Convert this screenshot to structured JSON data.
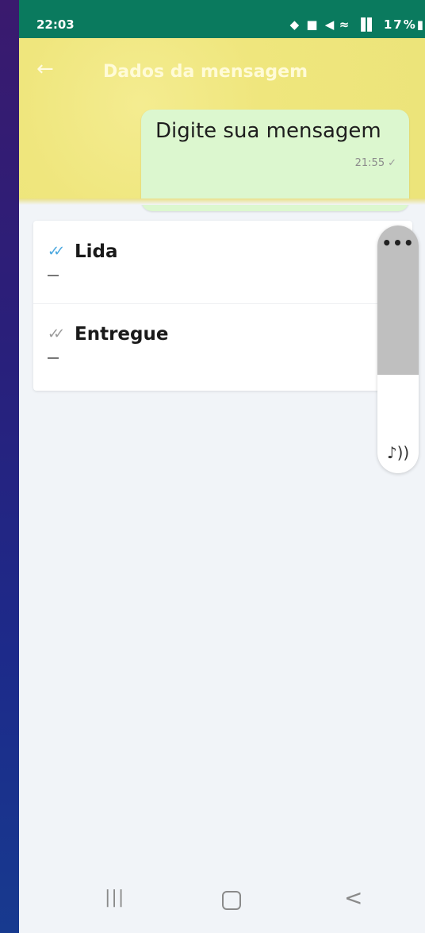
{
  "status_bar": {
    "time": "22:03",
    "icons": "◆ ■ ◀ ≈ ▐▌ 17%▮",
    "battery": "17%"
  },
  "header": {
    "back_icon": "←",
    "title": "Dados da mensagem"
  },
  "message": {
    "text": "Digite sua mensagem",
    "time": "21:55",
    "check": "✓"
  },
  "receipts": [
    {
      "label": "Lida",
      "tick": "✓✓",
      "value": "—"
    },
    {
      "label": "Entregue",
      "tick": "✓✓",
      "value": "—"
    }
  ],
  "side_panel": {
    "more_icon": "•••",
    "sound_icon": "♪))"
  },
  "nav": {
    "recents_icon": "|||",
    "back_icon": "<"
  },
  "colors": {
    "status_bar": "#0a7a5e",
    "bubble": "#dcf7cf",
    "read_tick": "#4aa7df",
    "wallpaper": "#ece47a"
  }
}
